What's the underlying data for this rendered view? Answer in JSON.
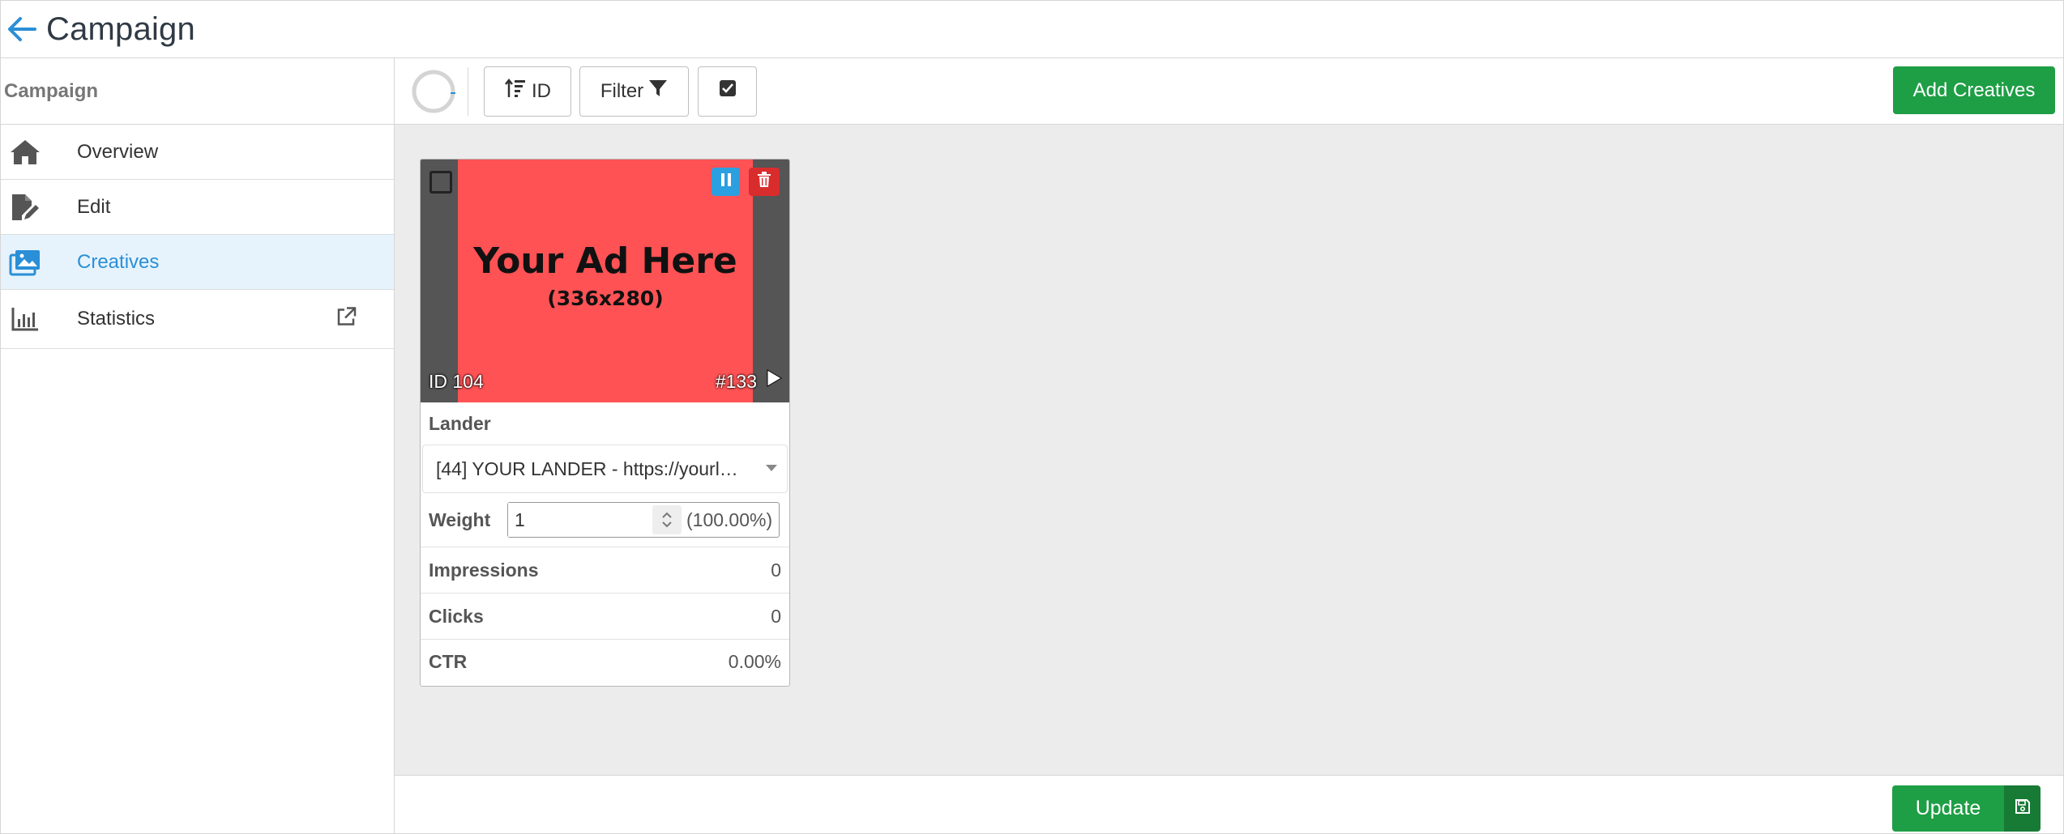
{
  "header": {
    "title": "Campaign",
    "back_icon": "arrow-left-icon",
    "accent": "#2a8fd6"
  },
  "sidebar": {
    "title": "Campaign",
    "items": [
      {
        "label": "Overview",
        "icon": "home-icon",
        "active": false
      },
      {
        "label": "Edit",
        "icon": "file-edit-icon",
        "active": false
      },
      {
        "label": "Creatives",
        "icon": "images-icon",
        "active": true
      },
      {
        "label": "Statistics",
        "icon": "bar-chart-icon",
        "active": false,
        "external": true
      }
    ]
  },
  "toolbar": {
    "sort_label": "ID",
    "filter_label": "Filter",
    "add_label": "Add Creatives",
    "add_color": "#1e9e45"
  },
  "creative": {
    "ad_title": "Your Ad Here",
    "ad_size": "(336x280)",
    "ad_color": "#ff5254",
    "id_label": "ID 104",
    "number_label": "#133",
    "lander_label": "Lander",
    "lander_value": "[44] YOUR LANDER - https://yourl…",
    "weight_label": "Weight",
    "weight_value": "1",
    "weight_percent": "(100.00%)",
    "stats": [
      {
        "label": "Impressions",
        "value": "0"
      },
      {
        "label": "Clicks",
        "value": "0"
      },
      {
        "label": "CTR",
        "value": "0.00%"
      }
    ]
  },
  "footer": {
    "update_label": "Update"
  }
}
